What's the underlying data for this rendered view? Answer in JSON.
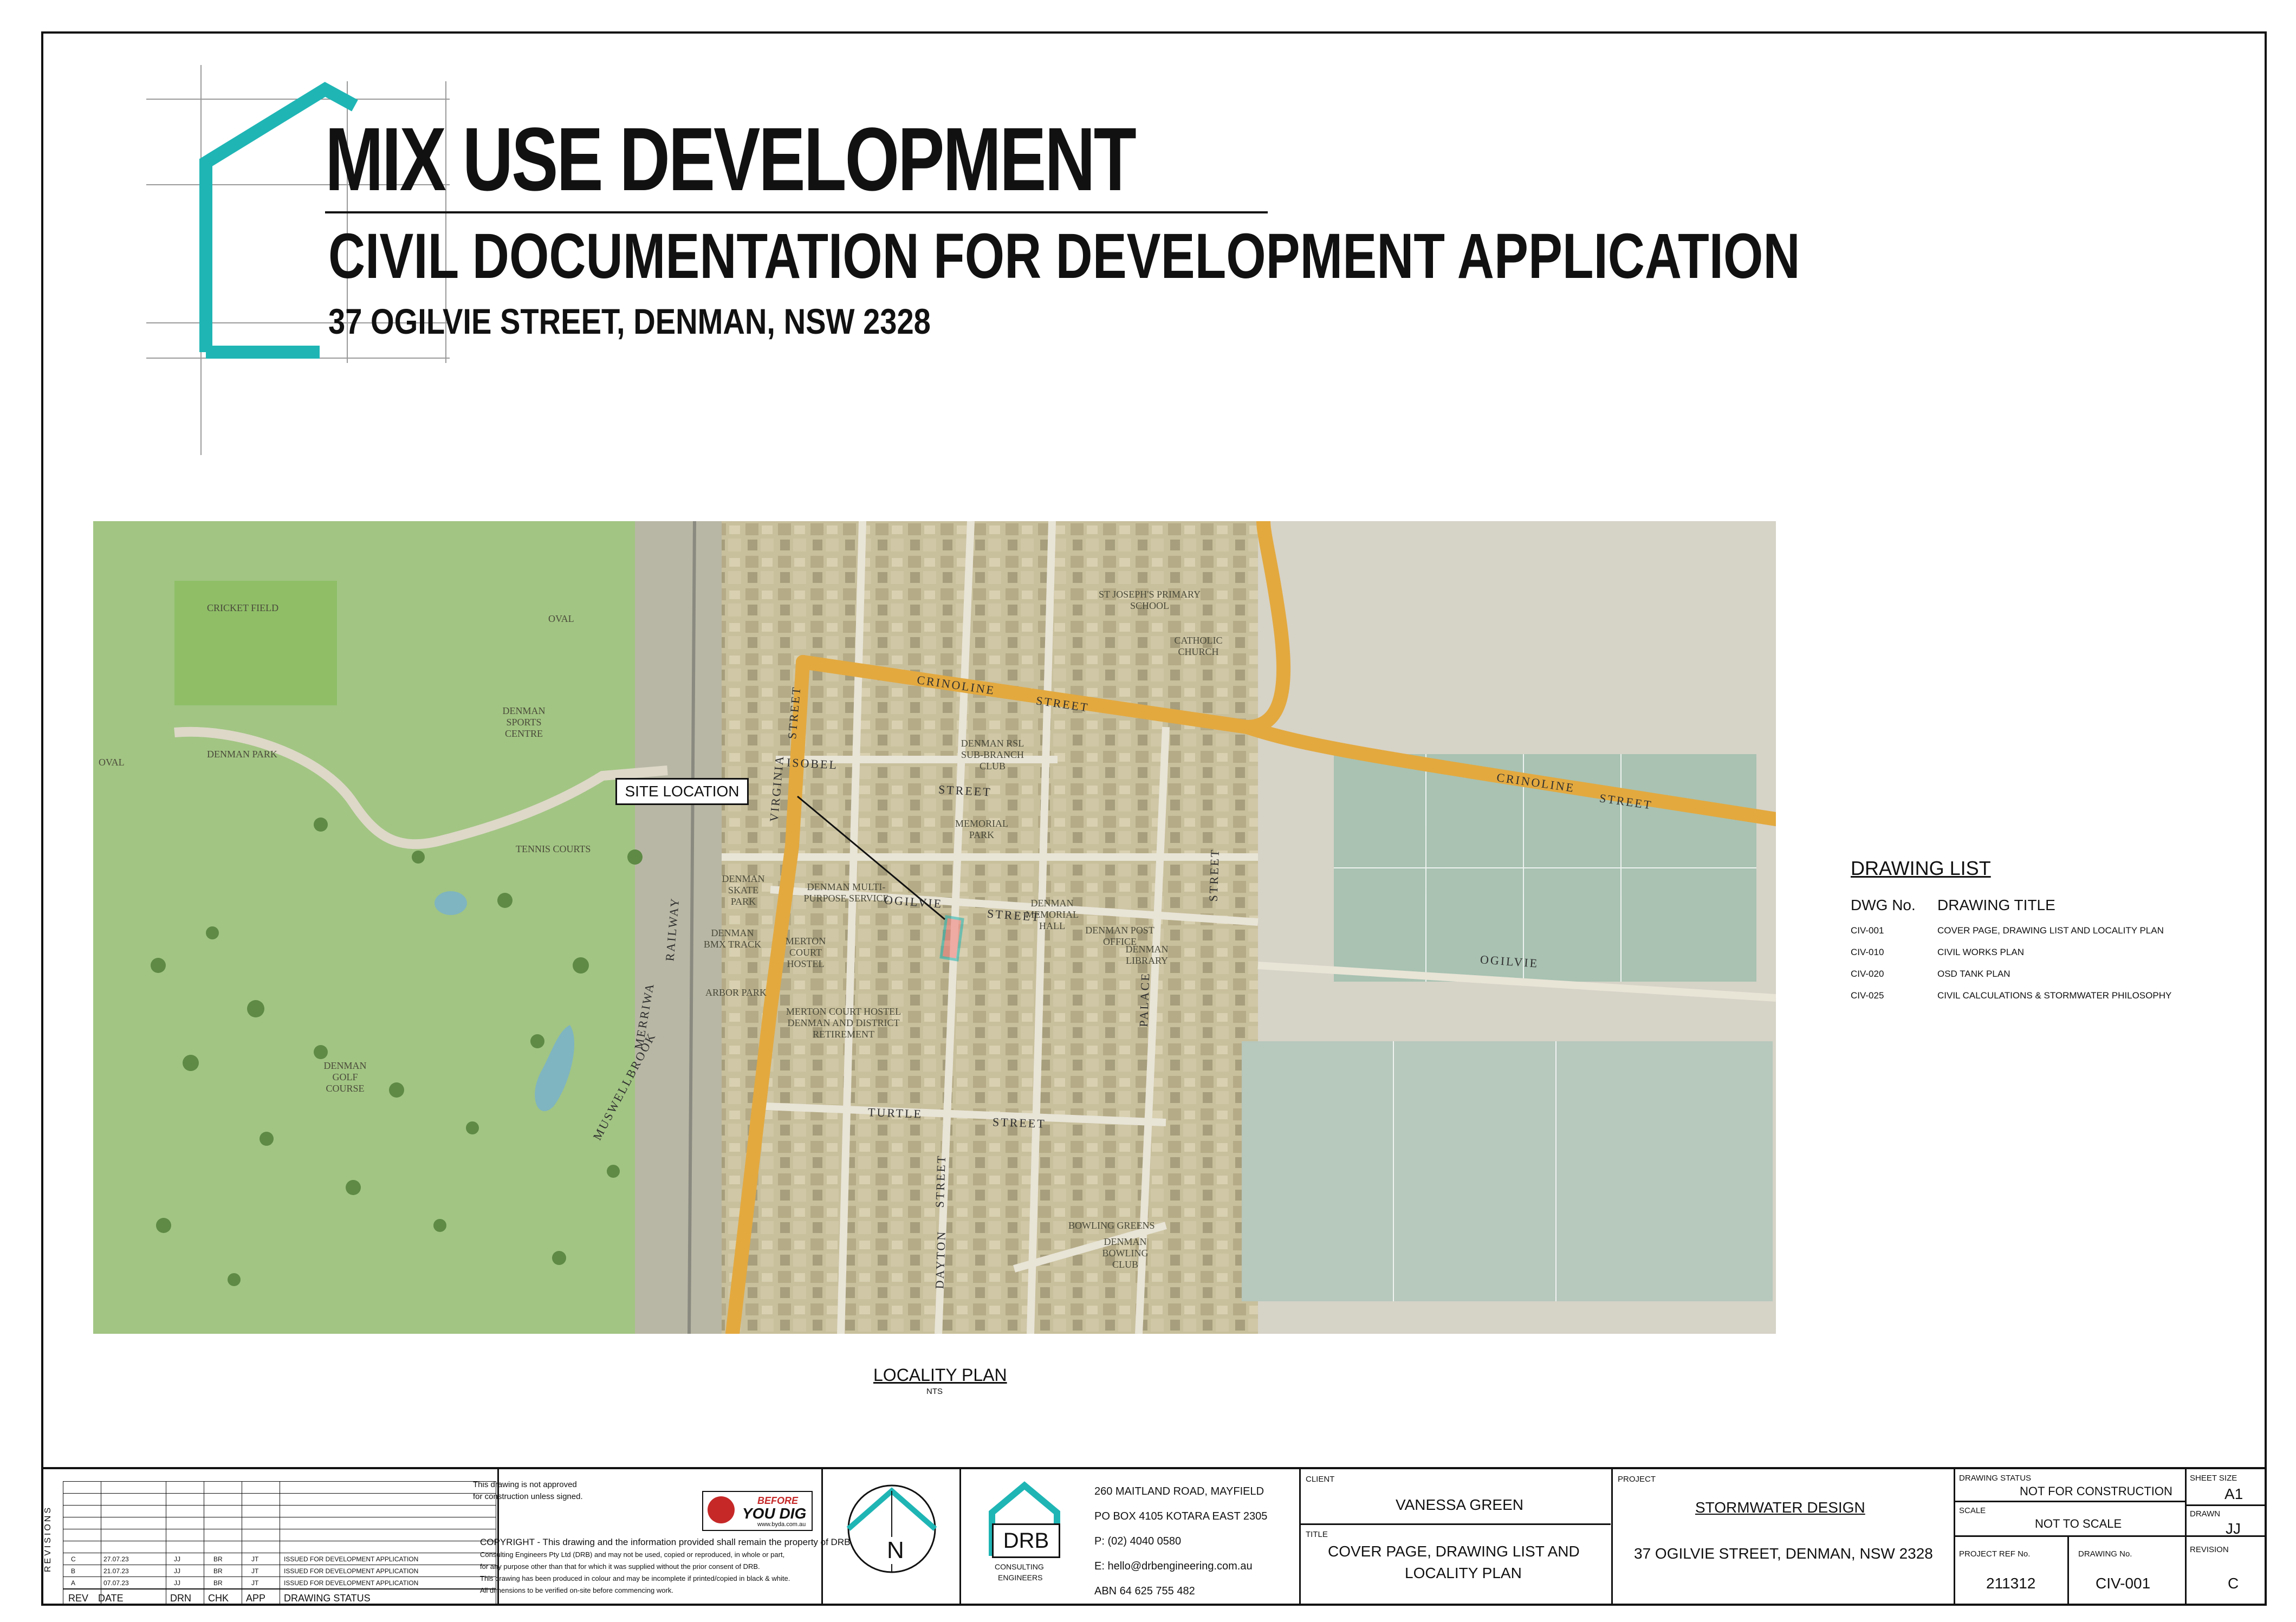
{
  "header": {
    "title": "MIX USE DEVELOPMENT",
    "subtitle": "CIVIL DOCUMENTATION FOR DEVELOPMENT APPLICATION",
    "address": "37 OGILVIE STREET, DENMAN, NSW 2328"
  },
  "colors": {
    "brand_teal": "#1fb5b5",
    "road_orange": "#e3a93f",
    "line": "#111111"
  },
  "map": {
    "site_label": "SITE LOCATION",
    "places": [
      "CRICKET FIELD",
      "OVAL",
      "DENMAN SPORTS CENTRE",
      "DENMAN PARK",
      "TENNIS COURTS",
      "DENMAN SKATE PARK",
      "DENMAN BMX TRACK",
      "ARBOR PARK",
      "DENMAN GOLF COURSE",
      "ST JOSEPH'S PRIMARY SCHOOL",
      "CATHOLIC CHURCH",
      "DENMAN RSL SUB-BRANCH CLUB",
      "MEMORIAL PARK",
      "DENMAN MEMORIAL HALL",
      "DENMAN POST OFFICE",
      "DENMAN LIBRARY",
      "DENMAN MULTI-PURPOSE SERVICE",
      "MERTON COURT HOSTEL",
      "MERTON COURT HOSTEL DENMAN AND DISTRICT RETIREMENT",
      "BOWLING GREENS",
      "DENMAN BOWLING CLUB",
      "OVAL"
    ],
    "streets": [
      "CRINOLINE",
      "STREET",
      "CRINOLINE",
      "STREET",
      "VIRGINIA",
      "STREET",
      "ISOBEL",
      "STREET",
      "OGILVIE",
      "STREET",
      "OGILVIE",
      "TURTLE",
      "STREET",
      "DAYTON",
      "STREET",
      "PALACE",
      "STREET",
      "RAILWAY",
      "MERRIWA",
      "MUSWELLBROOK"
    ]
  },
  "drawing_list": {
    "title": "DRAWING LIST",
    "col_no": "DWG No.",
    "col_title": "DRAWING TITLE",
    "rows": [
      {
        "no": "CIV-001",
        "title": "COVER PAGE, DRAWING LIST AND LOCALITY PLAN"
      },
      {
        "no": "CIV-010",
        "title": "CIVIL WORKS PLAN"
      },
      {
        "no": "CIV-020",
        "title": "OSD TANK PLAN"
      },
      {
        "no": "CIV-025",
        "title": "CIVIL CALCULATIONS & STORMWATER PHILOSOPHY"
      }
    ]
  },
  "locality": {
    "title": "LOCALITY PLAN",
    "scale": "NTS"
  },
  "title_block": {
    "revisions_label": "REVISIONS",
    "rev_headers": [
      "REV",
      "DATE",
      "DRN",
      "CHK",
      "APP",
      "DRAWING STATUS"
    ],
    "revisions": [
      {
        "rev": "C",
        "date": "27.07.23",
        "drn": "JJ",
        "chk": "BR",
        "app": "JT",
        "status": "ISSUED FOR DEVELOPMENT APPLICATION"
      },
      {
        "rev": "B",
        "date": "21.07.23",
        "drn": "JJ",
        "chk": "BR",
        "app": "JT",
        "status": "ISSUED FOR DEVELOPMENT APPLICATION"
      },
      {
        "rev": "A",
        "date": "07.07.23",
        "drn": "JJ",
        "chk": "BR",
        "app": "JT",
        "status": "ISSUED FOR DEVELOPMENT APPLICATION"
      }
    ],
    "approval_note_1": "This drawing is not approved",
    "approval_note_2": "for construction unless signed.",
    "byda_1": "BEFORE",
    "byda_2": "YOU DIG",
    "byda_3": "www.byda.com.au",
    "copyright_lines": [
      "COPYRIGHT - This drawing and the information provided shall remain the property of DRB",
      "Consulting Engineers Pty Ltd (DRB) and may not be used, copied or reproduced, in whole or part,",
      "for any purpose other than that for which it was supplied without the prior consent of DRB.",
      "This drawing has been produced in colour and may be incomplete if printed/copied in black & white.",
      "All dimensions to be verified on-site before commencing work."
    ],
    "north": "N",
    "company_logo": "DRB",
    "company_sub_1": "CONSULTING",
    "company_sub_2": "ENGINEERS",
    "address_1": "260 MAITLAND ROAD, MAYFIELD",
    "address_2": "PO BOX 4105 KOTARA EAST 2305",
    "phone": "P: (02) 4040 0580",
    "email": "E: hello@drbengineering.com.au",
    "abn": "ABN 64 625 755 482",
    "client_label": "CLIENT",
    "client": "VANESSA GREEN",
    "title_label": "TITLE",
    "title_1": "COVER PAGE, DRAWING LIST AND",
    "title_2": "LOCALITY PLAN",
    "project_label": "PROJECT",
    "project_1": "STORMWATER DESIGN",
    "project_2": "37 OGILVIE STREET, DENMAN, NSW 2328",
    "status_label": "DRAWING STATUS",
    "status": "NOT FOR CONSTRUCTION",
    "scale_label": "SCALE",
    "scale": "NOT TO SCALE",
    "ref_label": "PROJECT REF No.",
    "ref": "211312",
    "dwg_label": "DRAWING No.",
    "dwg": "CIV-001",
    "sheet_label": "SHEET SIZE",
    "sheet": "A1",
    "drawn_label": "DRAWN",
    "drawn": "JJ",
    "revision_label": "REVISION",
    "revision": "C"
  }
}
